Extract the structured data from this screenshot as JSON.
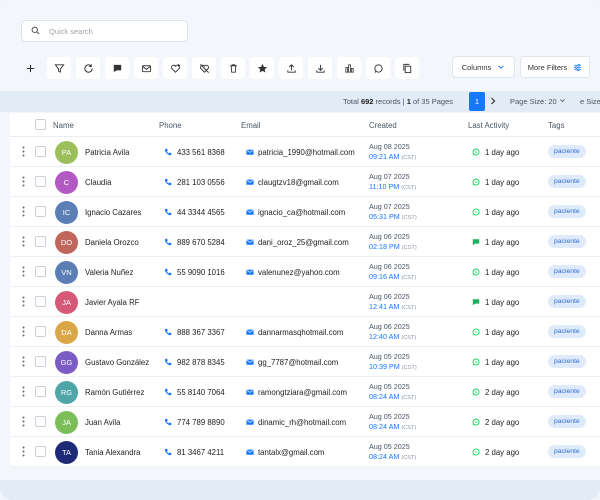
{
  "search": {
    "placeholder": "Quick search"
  },
  "toolbar": {
    "columns_label": "Columns",
    "filters_label": "More Filters",
    "icons": [
      "plus-icon",
      "filter-icon",
      "refresh-icon",
      "chat-icon",
      "mail-icon",
      "heart-add-icon",
      "heart-remove-icon",
      "trash-icon",
      "star-icon",
      "upload-icon",
      "download-icon",
      "chart-icon",
      "whatsapp-icon",
      "copy-icon"
    ]
  },
  "pagination": {
    "total_prefix": "Total",
    "total_count": "692",
    "total_suffix": "records |",
    "page_bold": "1",
    "page_rest": "of 35 Pages",
    "current_page": "1",
    "page_size": "Page Size: 20",
    "page_size_cut": "e Size:"
  },
  "columns": {
    "name": "Name",
    "phone": "Phone",
    "email": "Email",
    "created": "Created",
    "last_activity": "Last Activity",
    "tags": "Tags"
  },
  "colors": {
    "accent": "#1677ff",
    "whatsapp": "#25d366",
    "chat": "#1fae5b"
  },
  "rows": [
    {
      "initials": "PA",
      "color": "#9bbf5a",
      "name": "Patricia Avila",
      "phone": "433 561 8368",
      "email": "patricia_1990@hotmail.com",
      "date": "Aug 08 2025",
      "time": "09:21 AM",
      "tz": "(CST)",
      "activity": "1 day ago",
      "act_icon": "whatsapp",
      "tag": "paciente"
    },
    {
      "initials": "C",
      "color": "#b359c4",
      "name": "Claudia",
      "phone": "281 103 0556",
      "email": "claugtzv18@gmail.com",
      "date": "Aug 07 2025",
      "time": "11:10 PM",
      "tz": "(CST)",
      "activity": "1 day ago",
      "act_icon": "whatsapp",
      "tag": "paciente"
    },
    {
      "initials": "IC",
      "color": "#5b7fb5",
      "name": "Ignacio Cazares",
      "phone": "44 3344  4565",
      "email": "ignacio_ca@hotmail.com",
      "date": "Aug 07 2025",
      "time": "05:31 PM",
      "tz": "(CST)",
      "activity": "1 day ago",
      "act_icon": "whatsapp",
      "tag": "paciente"
    },
    {
      "initials": "DO",
      "color": "#c0665a",
      "name": "Daniela Orozco",
      "phone": "889 670 5284",
      "email": "dani_oroz_25@gmail.com",
      "date": "Aug 06 2025",
      "time": "02:18 PM",
      "tz": "(CST)",
      "activity": "1 day ago",
      "act_icon": "chat",
      "tag": "paciente"
    },
    {
      "initials": "VN",
      "color": "#5b7fb5",
      "name": "Valeria Nuñez",
      "phone": "55 9090 1016",
      "email": "valenunez@yahoo.com",
      "date": "Aug 06 2025",
      "time": "09:16 AM",
      "tz": "(CST)",
      "activity": "1 day ago",
      "act_icon": "whatsapp",
      "tag": "paciente"
    },
    {
      "initials": "JA",
      "color": "#d65a78",
      "name": "Javier Ayala RF",
      "phone": "",
      "email": "",
      "date": "Aug 06 2025",
      "time": "12:41 AM",
      "tz": "(CST)",
      "activity": "1 day ago",
      "act_icon": "chat",
      "tag": "paciente"
    },
    {
      "initials": "DA",
      "color": "#d9a748",
      "name": "Danna Armas",
      "phone": "888 367 3367",
      "email": "dannarmasqhotmail.com",
      "date": "Aug 06 2025",
      "time": "12:40 AM",
      "tz": "(CST)",
      "activity": "1 day ago",
      "act_icon": "whatsapp",
      "tag": "paciente"
    },
    {
      "initials": "GG",
      "color": "#7a5cc4",
      "name": "Gustavo González",
      "phone": "982 878 8345",
      "email": "gg_7787@hotmail.com",
      "date": "Aug 05 2025",
      "time": "10:39 PM",
      "tz": "(CST)",
      "activity": "1 day ago",
      "act_icon": "whatsapp",
      "tag": "paciente"
    },
    {
      "initials": "RG",
      "color": "#4fa5a8",
      "name": "Ramón Gutiérrez",
      "phone": "55 8140 7064",
      "email": "ramongtziara@gmail.com",
      "date": "Aug 05 2025",
      "time": "08:24 AM",
      "tz": "(CST)",
      "activity": "2 day ago",
      "act_icon": "whatsapp",
      "tag": "paciente"
    },
    {
      "initials": "JA",
      "color": "#7cbf5a",
      "name": "Juan Avila",
      "phone": "774 789 8890",
      "email": "dinamic_rh@hotmail.com",
      "date": "Aug 05 2025",
      "time": "08:24 AM",
      "tz": "(CST)",
      "activity": "2 day ago",
      "act_icon": "whatsapp",
      "tag": "paciente"
    },
    {
      "initials": "TA",
      "color": "#1e2a78",
      "name": "Tania Alexandra",
      "phone": "81 3467 4211",
      "email": "tantalx@gmail.com",
      "date": "Aug 05 2025",
      "time": "08:24 AM",
      "tz": "(CST)",
      "activity": "2 day ago",
      "act_icon": "whatsapp",
      "tag": "paciente"
    }
  ]
}
